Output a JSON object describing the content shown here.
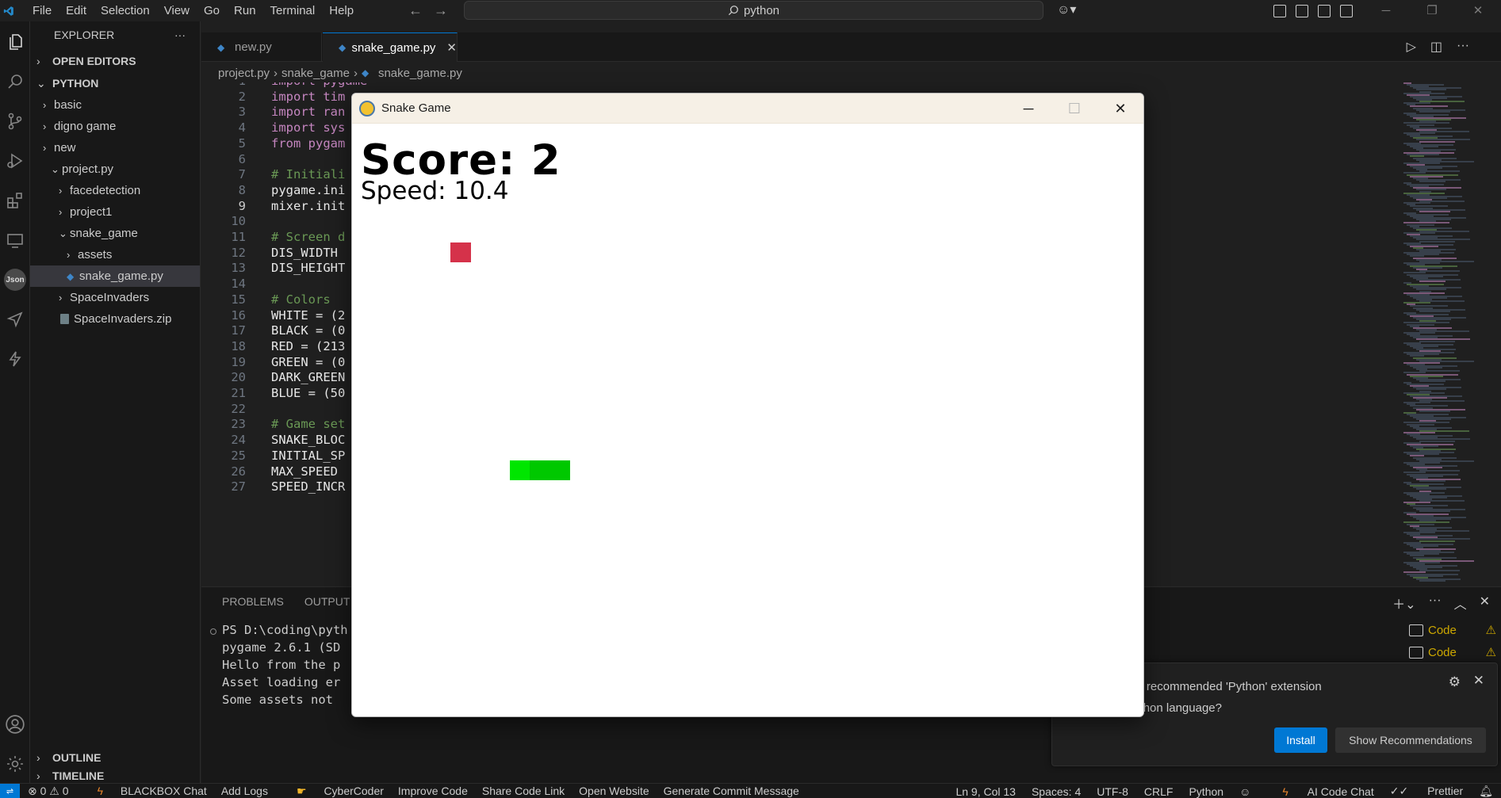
{
  "menu": [
    "File",
    "Edit",
    "Selection",
    "View",
    "Go",
    "Run",
    "Terminal",
    "Help"
  ],
  "search": {
    "text": "python"
  },
  "sidebar": {
    "title": "EXPLORER",
    "open_editors": "OPEN EDITORS",
    "workspace": "PYTHON",
    "items": [
      {
        "label": "basic"
      },
      {
        "label": "digno game"
      },
      {
        "label": "new"
      },
      {
        "label": "project.py"
      },
      {
        "label": "facedetection"
      },
      {
        "label": "project1"
      },
      {
        "label": "snake_game"
      },
      {
        "label": "assets"
      },
      {
        "label": "snake_game.py"
      },
      {
        "label": "SpaceInvaders"
      },
      {
        "label": "SpaceInvaders.zip"
      }
    ],
    "outline": "OUTLINE",
    "timeline": "TIMELINE"
  },
  "tabs": [
    {
      "label": "new.py"
    },
    {
      "label": "snake_game.py"
    }
  ],
  "breadcrumb": [
    "project.py",
    "snake_game",
    "snake_game.py"
  ],
  "code_lines": [
    {
      "n": "1",
      "t": "import pygame"
    },
    {
      "n": "2",
      "t": "import tim"
    },
    {
      "n": "3",
      "t": "import ran"
    },
    {
      "n": "4",
      "t": "import sys"
    },
    {
      "n": "5",
      "t": "from pygam"
    },
    {
      "n": "6",
      "t": ""
    },
    {
      "n": "7",
      "t": "# Initiali"
    },
    {
      "n": "8",
      "t": "pygame.ini"
    },
    {
      "n": "9",
      "t": "mixer.init"
    },
    {
      "n": "10",
      "t": ""
    },
    {
      "n": "11",
      "t": "# Screen d"
    },
    {
      "n": "12",
      "t": "DIS_WIDTH"
    },
    {
      "n": "13",
      "t": "DIS_HEIGHT"
    },
    {
      "n": "14",
      "t": ""
    },
    {
      "n": "15",
      "t": "# Colors"
    },
    {
      "n": "16",
      "t": "WHITE = (2"
    },
    {
      "n": "17",
      "t": "BLACK = (0"
    },
    {
      "n": "18",
      "t": "RED = (213"
    },
    {
      "n": "19",
      "t": "GREEN = (0"
    },
    {
      "n": "20",
      "t": "DARK_GREEN"
    },
    {
      "n": "21",
      "t": "BLUE = (50"
    },
    {
      "n": "22",
      "t": ""
    },
    {
      "n": "23",
      "t": "# Game set"
    },
    {
      "n": "24",
      "t": "SNAKE_BLOC"
    },
    {
      "n": "25",
      "t": "INITIAL_SP"
    },
    {
      "n": "26",
      "t": "MAX_SPEED"
    },
    {
      "n": "27",
      "t": "SPEED_INCR"
    }
  ],
  "panel": {
    "tabs": [
      "PROBLEMS",
      "OUTPUT"
    ],
    "terminal_lines": [
      "PS D:\\coding\\pyth",
      "pygame 2.6.1 (SD",
      "Hello from the p",
      "Asset loading er",
      "Some assets not "
    ],
    "terminals": [
      "Code",
      "Code"
    ]
  },
  "notification": {
    "message_line1": "nt to install the recommended 'Python' extension",
    "message_line2": "soft for the Python language?",
    "install": "Install",
    "recommendations": "Show Recommendations"
  },
  "statusbar": {
    "left": [
      "0",
      "0",
      "BLACKBOX Chat",
      "Add Logs",
      "CyberCoder",
      "Improve Code",
      "Share Code Link",
      "Open Website",
      "Generate Commit Message"
    ],
    "right": [
      "Ln 9, Col 13",
      "Spaces: 4",
      "UTF-8",
      "CRLF",
      "Python",
      "AI Code Chat",
      "Prettier"
    ]
  },
  "game": {
    "title": "Snake Game",
    "score": "Score: 2",
    "speed": "Speed: 10.4",
    "food_color": "#d5324a",
    "snake_head_color": "#00e600",
    "snake_body_color": "#00c800"
  }
}
